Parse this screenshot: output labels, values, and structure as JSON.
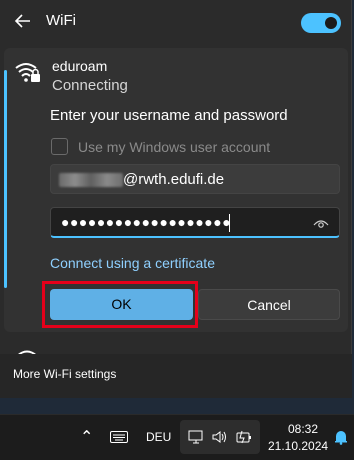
{
  "header": {
    "title": "WiFi",
    "back_icon": "back-arrow-icon",
    "toggle_on": true
  },
  "network": {
    "name": "eduroam",
    "status": "Connecting",
    "icon": "wifi-secured-icon"
  },
  "form": {
    "prompt": "Enter your username and password",
    "checkbox_label": "Use my Windows user account",
    "checkbox_checked": false,
    "username_suffix": "@rwth.edufi.de",
    "password_mask": "●●●●●●●●●●●●●●●●●●●",
    "cert_link": "Connect using a certificate",
    "ok_label": "OK",
    "cancel_label": "Cancel"
  },
  "footer": {
    "link": "More Wi-Fi settings"
  },
  "taskbar": {
    "language": "DEU",
    "time": "08:32",
    "date": "21.10.2024"
  },
  "colors": {
    "accent": "#4cc2ff",
    "highlight": "#e5001a",
    "ok_button": "#5fb0e6"
  }
}
